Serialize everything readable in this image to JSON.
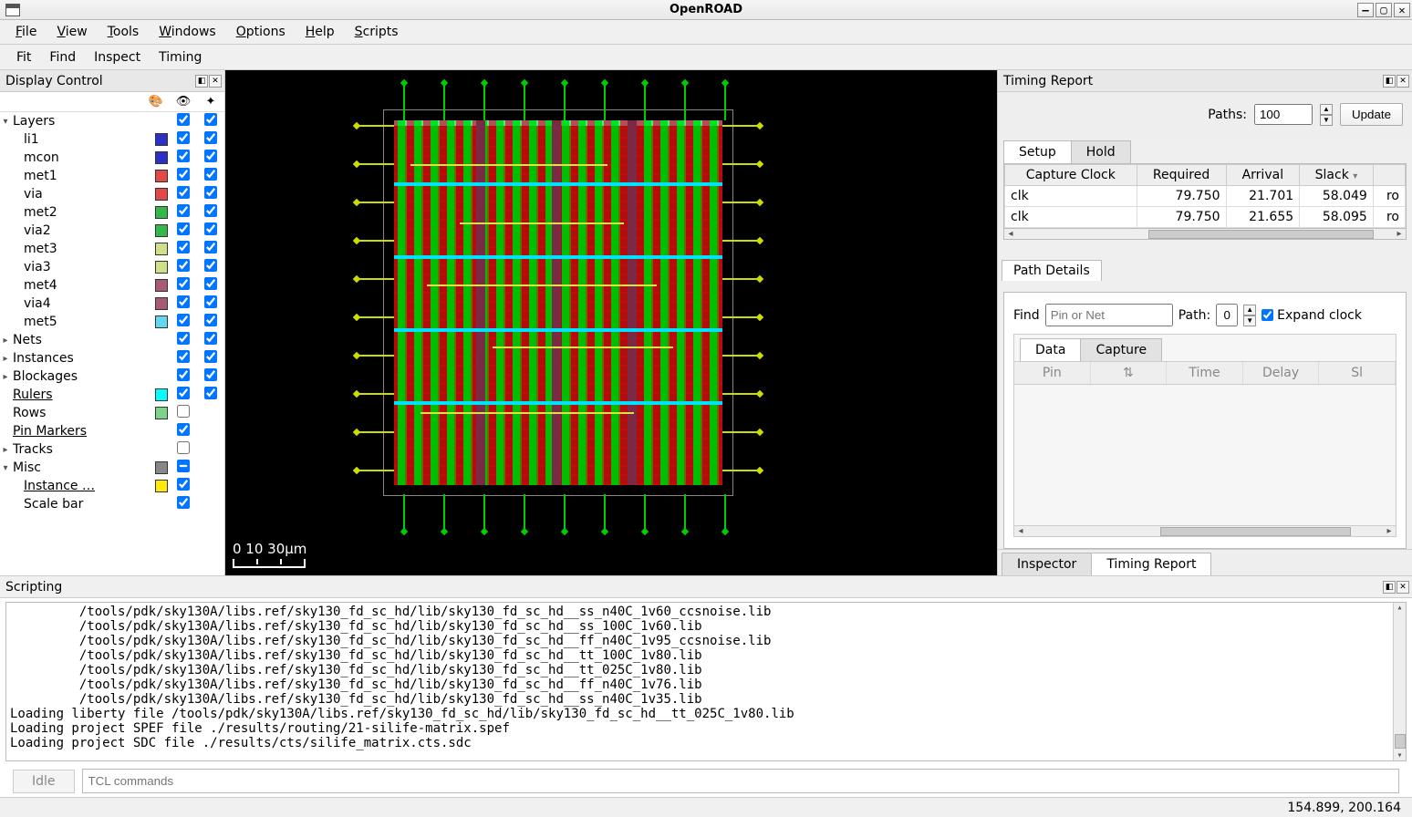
{
  "window": {
    "title": "OpenROAD"
  },
  "menubar": [
    "File",
    "View",
    "Tools",
    "Windows",
    "Options",
    "Help",
    "Scripts"
  ],
  "toolbar": [
    "Fit",
    "Find",
    "Inspect",
    "Timing"
  ],
  "display_control": {
    "title": "Display Control",
    "col_icons": [
      "🎨",
      "👁",
      "✦"
    ],
    "tree": [
      {
        "type": "group",
        "expand": "▾",
        "label": "Layers",
        "vis": true,
        "sel": true
      },
      {
        "type": "layer",
        "indent": 2,
        "label": "li1",
        "color": "#2a30c8",
        "vis": true,
        "sel": true
      },
      {
        "type": "layer",
        "indent": 2,
        "label": "mcon",
        "color": "#2a30c8",
        "vis": true,
        "sel": true
      },
      {
        "type": "layer",
        "indent": 2,
        "label": "met1",
        "color": "#e24848",
        "vis": true,
        "sel": true
      },
      {
        "type": "layer",
        "indent": 2,
        "label": "via",
        "color": "#e24848",
        "vis": true,
        "sel": true
      },
      {
        "type": "layer",
        "indent": 2,
        "label": "met2",
        "color": "#35b84a",
        "vis": true,
        "sel": true
      },
      {
        "type": "layer",
        "indent": 2,
        "label": "via2",
        "color": "#35b84a",
        "vis": true,
        "sel": true
      },
      {
        "type": "layer",
        "indent": 2,
        "label": "met3",
        "color": "#cfe08a",
        "vis": true,
        "sel": true
      },
      {
        "type": "layer",
        "indent": 2,
        "label": "via3",
        "color": "#cfe08a",
        "vis": true,
        "sel": true
      },
      {
        "type": "layer",
        "indent": 2,
        "label": "met4",
        "color": "#a85a74",
        "vis": true,
        "sel": true
      },
      {
        "type": "layer",
        "indent": 2,
        "label": "via4",
        "color": "#a85a74",
        "vis": true,
        "sel": true
      },
      {
        "type": "layer",
        "indent": 2,
        "label": "met5",
        "color": "#62d8f0",
        "vis": true,
        "sel": true
      },
      {
        "type": "group",
        "expand": "▸",
        "label": "Nets",
        "vis": true,
        "sel": true
      },
      {
        "type": "group",
        "expand": "▸",
        "label": "Instances",
        "vis": true,
        "sel": true
      },
      {
        "type": "group",
        "expand": "▸",
        "label": "Blockages",
        "vis": true,
        "sel": true
      },
      {
        "type": "item",
        "indent": 1,
        "label": "Rulers",
        "ul": true,
        "color": "#00ffff",
        "vis": true,
        "sel": true
      },
      {
        "type": "item",
        "indent": 1,
        "label": "Rows",
        "color": "#7dd489",
        "vis": false
      },
      {
        "type": "item",
        "indent": 1,
        "label": "Pin Markers",
        "ul": true,
        "vis": true
      },
      {
        "type": "group",
        "expand": "▸",
        "label": "Tracks",
        "vis": false
      },
      {
        "type": "group",
        "expand": "▾",
        "label": "Misc",
        "color": "#888",
        "mixed": true
      },
      {
        "type": "item",
        "indent": 2,
        "label": "Instance …",
        "ul": true,
        "color": "#ffea00",
        "vis": true
      },
      {
        "type": "item",
        "indent": 2,
        "label": "Scale bar",
        "vis": true
      }
    ]
  },
  "scale_bar": {
    "labels": "0  10   30µm"
  },
  "timing": {
    "title": "Timing Report",
    "paths_label": "Paths:",
    "paths_value": "100",
    "update_label": "Update",
    "tabs": [
      "Setup",
      "Hold"
    ],
    "columns": [
      "Capture Clock",
      "Required",
      "Arrival",
      "Slack",
      ""
    ],
    "rows": [
      {
        "clock": "clk",
        "required": "79.750",
        "arrival": "21.701",
        "slack": "58.049",
        "extra": "ro"
      },
      {
        "clock": "clk",
        "required": "79.750",
        "arrival": "21.655",
        "slack": "58.095",
        "extra": "ro"
      }
    ],
    "path_details": {
      "title": "Path Details",
      "find_label": "Find",
      "find_placeholder": "Pin or Net",
      "path_label": "Path:",
      "path_value": "0",
      "expand_label": "Expand clock",
      "tabs": [
        "Data",
        "Capture"
      ],
      "columns": [
        "Pin",
        "⇅",
        "Time",
        "Delay",
        "Sl"
      ]
    },
    "bottom_tabs": [
      "Inspector",
      "Timing Report"
    ]
  },
  "scripting": {
    "title": "Scripting",
    "lines": [
      "         /tools/pdk/sky130A/libs.ref/sky130_fd_sc_hd/lib/sky130_fd_sc_hd__ss_n40C_1v60_ccsnoise.lib",
      "         /tools/pdk/sky130A/libs.ref/sky130_fd_sc_hd/lib/sky130_fd_sc_hd__ss_100C_1v60.lib",
      "         /tools/pdk/sky130A/libs.ref/sky130_fd_sc_hd/lib/sky130_fd_sc_hd__ff_n40C_1v95_ccsnoise.lib",
      "         /tools/pdk/sky130A/libs.ref/sky130_fd_sc_hd/lib/sky130_fd_sc_hd__tt_100C_1v80.lib",
      "         /tools/pdk/sky130A/libs.ref/sky130_fd_sc_hd/lib/sky130_fd_sc_hd__tt_025C_1v80.lib",
      "         /tools/pdk/sky130A/libs.ref/sky130_fd_sc_hd/lib/sky130_fd_sc_hd__ff_n40C_1v76.lib",
      "         /tools/pdk/sky130A/libs.ref/sky130_fd_sc_hd/lib/sky130_fd_sc_hd__ss_n40C_1v35.lib",
      "Loading liberty file /tools/pdk/sky130A/libs.ref/sky130_fd_sc_hd/lib/sky130_fd_sc_hd__tt_025C_1v80.lib",
      "Loading project SPEF file ./results/routing/21-silife-matrix.spef",
      "Loading project SDC file ./results/cts/silife_matrix.cts.sdc"
    ],
    "idle_label": "Idle",
    "input_placeholder": "TCL commands"
  },
  "statusbar": {
    "coords": "154.899, 200.164"
  }
}
